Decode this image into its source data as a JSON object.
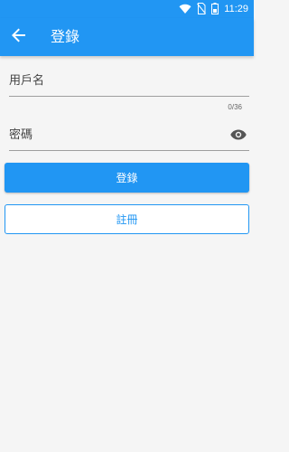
{
  "status_bar": {
    "time": "11:29",
    "icons": [
      "wifi-icon",
      "no-sim-icon",
      "battery-icon"
    ]
  },
  "app_bar": {
    "title": "登錄",
    "back_icon": "arrow-back-icon"
  },
  "form": {
    "username_placeholder": "用戶名",
    "username_value": "",
    "counter": "0/36",
    "password_placeholder": "密碼",
    "password_value": "",
    "visibility_icon": "eye-icon"
  },
  "buttons": {
    "login_label": "登錄",
    "register_label": "註冊"
  },
  "colors": {
    "primary": "#2196f3",
    "background": "#f5f5f5"
  }
}
